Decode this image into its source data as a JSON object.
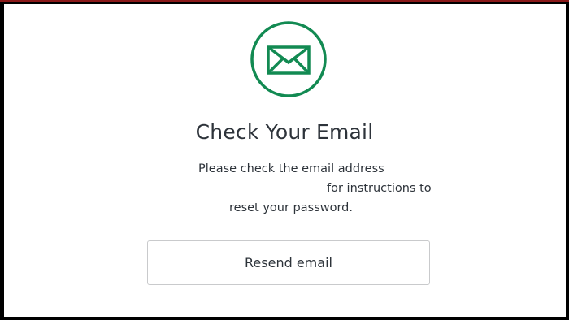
{
  "icon": {
    "name": "envelope-icon",
    "color": "#128a52"
  },
  "title": "Check Your Email",
  "message": {
    "line1": "Please check the email address",
    "line2": "for instructions to",
    "line3": "reset your password."
  },
  "resend_button": {
    "label": "Resend email"
  }
}
